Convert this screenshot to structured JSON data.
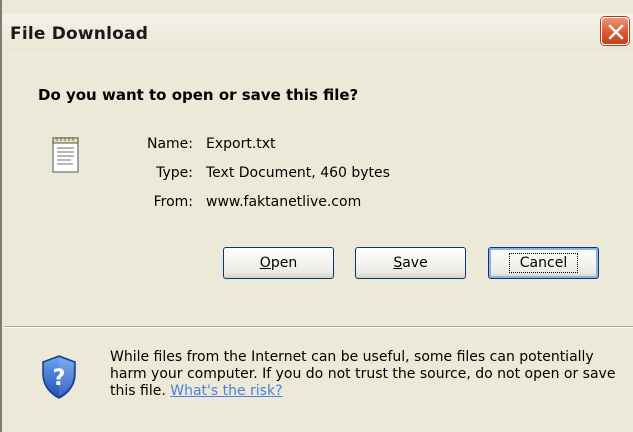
{
  "window": {
    "title": "File Download"
  },
  "question": "Do you want to open or save this file?",
  "file": {
    "icon": "text-document-icon",
    "name_label": "Name:",
    "name": "Export.txt",
    "type_label": "Type:",
    "type": "Text Document, 460 bytes",
    "from_label": "From:",
    "from": "www.faktanetlive.com"
  },
  "buttons": {
    "open_accel": "O",
    "open_rest": "pen",
    "save_accel": "S",
    "save_rest": "ave",
    "cancel": "Cancel"
  },
  "warning": {
    "text": "While files from the Internet can be useful, some files can potentially harm your computer. If you do not trust the source, do not open or save this file.",
    "link": "What's the risk?",
    "icon": "shield-question-icon"
  },
  "colors": {
    "dialog_bg": "#ECE9D8",
    "close_button": "#D8542B",
    "link": "#4C7FE0",
    "button_border": "#003C74"
  }
}
